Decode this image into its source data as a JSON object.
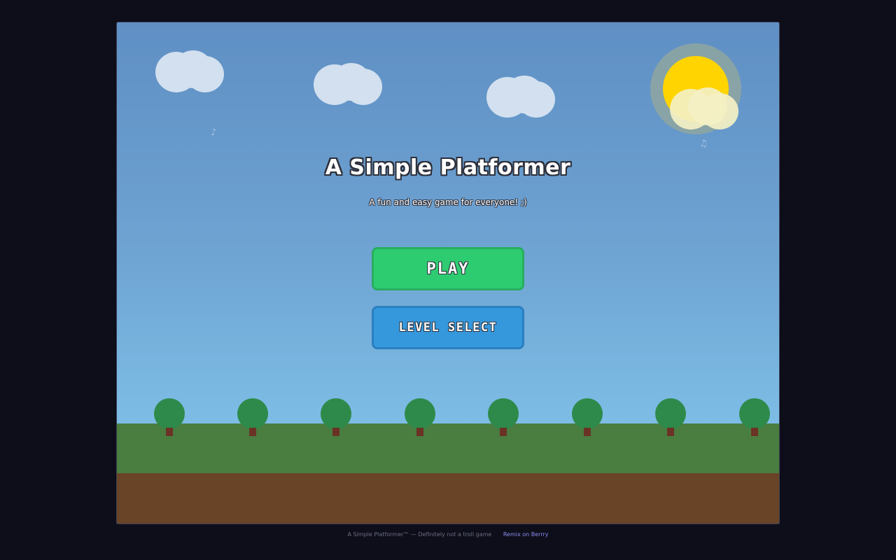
{
  "game": {
    "title": "A Simple Platformer",
    "subtitle": "A fun and easy game for everyone! ;)",
    "buttons": {
      "play_label": "PLAY",
      "level_select_label": "LEVEL SELECT"
    },
    "decorations": {
      "note_left": "♪",
      "note_right": "♫"
    }
  },
  "footer": {
    "text": "A Simple Platformer™ — Definitely not a troll game",
    "link_label": "Remix on Berrry"
  },
  "colors": {
    "sky_top": "#5f8fc4",
    "sky_bottom": "#80c2e8",
    "sun": "#ffd400",
    "grass": "#4a7d40",
    "dirt": "#6a4427",
    "tree_crown": "#2e8a4a",
    "tree_trunk": "#6a3325",
    "play_button": "#2ecc71",
    "level_select_button": "#3598dc",
    "page_background": "#0d0e1a",
    "footer_link": "#8b8cf0"
  },
  "icons": [
    "cloud-icon",
    "sun-icon",
    "music-note-icon",
    "tree-icon"
  ]
}
